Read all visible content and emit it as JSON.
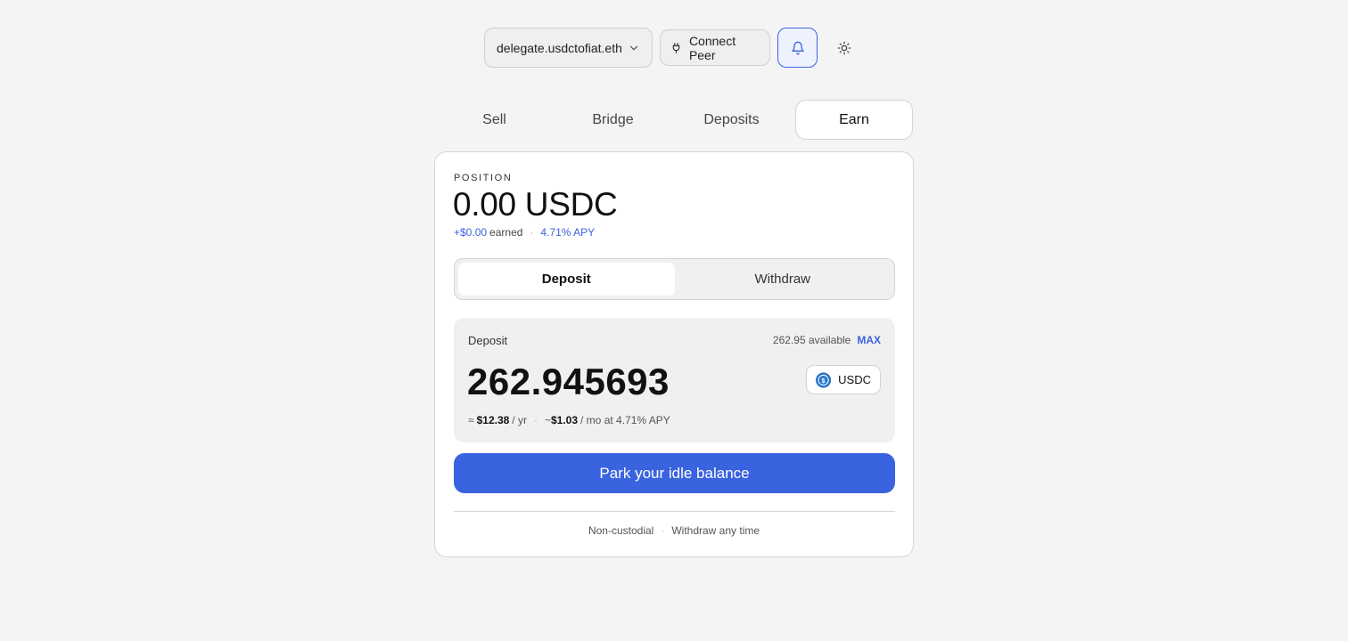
{
  "header": {
    "wallet_label": "delegate.usdctofiat.eth",
    "connect_label": "Connect Peer",
    "icons": {
      "chevron": "chevron-down-icon",
      "plug": "plug-icon",
      "bell": "bell-icon",
      "theme": "sun-icon"
    }
  },
  "tabs": [
    {
      "label": "Sell"
    },
    {
      "label": "Bridge"
    },
    {
      "label": "Deposits"
    },
    {
      "label": "Earn",
      "active": true
    }
  ],
  "position": {
    "label": "POSITION",
    "value": "0.00 USDC",
    "earned_amount": "+$0.00",
    "earned_label": "earned",
    "apy": "4.71% APY"
  },
  "segment": {
    "deposit": "Deposit",
    "withdraw": "Withdraw",
    "active": "Deposit"
  },
  "panel": {
    "label": "Deposit",
    "available": "262.95 available",
    "max": "MAX",
    "amount": "262.945693",
    "token": "USDC",
    "yearly_prefix": "≈",
    "yearly_value": "$12.38",
    "yearly_suffix": "/ yr",
    "monthly_prefix": "~",
    "monthly_value": "$1.03",
    "monthly_suffix": "/ mo at 4.71% APY"
  },
  "cta": {
    "label": "Park your idle balance"
  },
  "footer": {
    "left": "Non-custodial",
    "right": "Withdraw any time"
  },
  "colors": {
    "accent": "#3a63e0",
    "background": "#f4f4f4"
  }
}
